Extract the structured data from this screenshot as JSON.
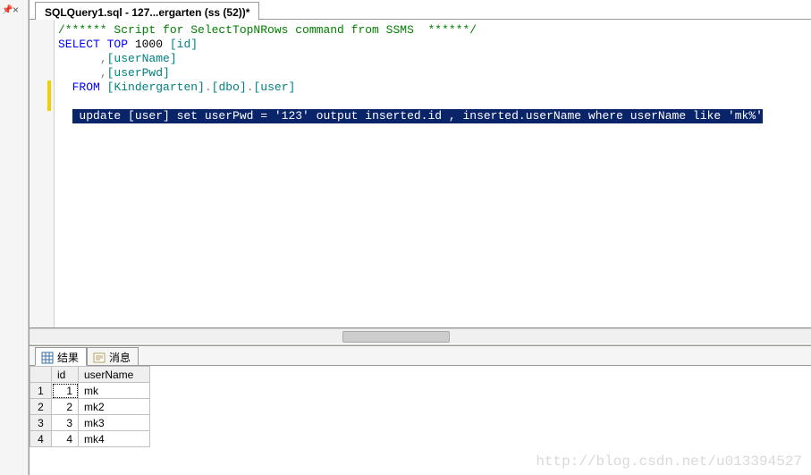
{
  "tab": {
    "title": "SQLQuery1.sql - 127...ergarten (ss (52))*"
  },
  "code": {
    "line1_comment": "/****** Script for SelectTopNRows command from SSMS  ******/",
    "line2_pre": "SELECT",
    "line2_mid": " TOP",
    "line2_num": " 1000 ",
    "line2_col": "[id]",
    "line3_indent": "      ",
    "line3_comma": ",",
    "line3_col": "[userName]",
    "line4_indent": "      ",
    "line4_comma": ",",
    "line4_col": "[userPwd]",
    "line5_indent": "  ",
    "line5_kw": "FROM",
    "line5_sp": " ",
    "line5_t1": "[Kindergarten]",
    "line5_d1": ".",
    "line5_t2": "[dbo]",
    "line5_d2": ".",
    "line5_t3": "[user]",
    "sel_indent": "  ",
    "sel": " update [user] set userPwd = '123' output inserted.id , inserted.userName where userName like 'mk%'"
  },
  "results": {
    "tabs": {
      "results": "结果",
      "messages": "消息"
    },
    "columns": [
      "",
      "id",
      "userName"
    ],
    "rows": [
      {
        "n": "1",
        "id": "1",
        "userName": "mk"
      },
      {
        "n": "2",
        "id": "2",
        "userName": "mk2"
      },
      {
        "n": "3",
        "id": "3",
        "userName": "mk3"
      },
      {
        "n": "4",
        "id": "4",
        "userName": "mk4"
      }
    ]
  },
  "watermark": "http://blog.csdn.net/u013394527"
}
